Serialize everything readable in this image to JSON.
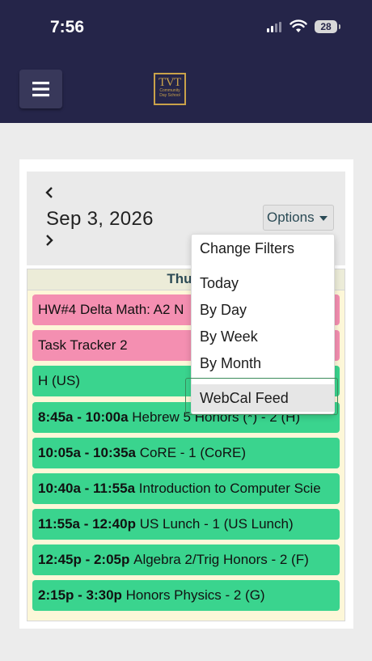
{
  "status_bar": {
    "time": "7:56",
    "battery": "28"
  },
  "header": {
    "menu_icon": "hamburger-icon",
    "logo": {
      "main": "TVT",
      "line1": "Community",
      "line2": "Day School"
    }
  },
  "calendar": {
    "date": "Sep 3, 2026",
    "prev_icon": "chevron-left-icon",
    "next_icon": "chevron-right-icon",
    "options_label": "Options",
    "day_header": "Thurs",
    "events": [
      {
        "time": "",
        "title": "HW#4 Delta Math: A2 N",
        "color": "pink"
      },
      {
        "time": "",
        "title": "Task Tracker 2",
        "color": "pink"
      },
      {
        "time": "",
        "title": "H (US)",
        "color": "green"
      },
      {
        "time": "8:45a - 10:00a",
        "title": "Hebrew 5 Honors (*) - 2 (H)",
        "color": "green"
      },
      {
        "time": "10:05a - 10:35a",
        "title": "CoRE - 1 (CoRE)",
        "color": "green"
      },
      {
        "time": "10:40a - 11:55a",
        "title": "Introduction to Computer Scie",
        "color": "green"
      },
      {
        "time": "11:55a - 12:40p",
        "title": "US Lunch - 1 (US Lunch)",
        "color": "green"
      },
      {
        "time": "12:45p - 2:05p",
        "title": "Algebra 2/Trig Honors - 2 (F)",
        "color": "green"
      },
      {
        "time": "2:15p - 3:30p",
        "title": "Honors Physics - 2 (G)",
        "color": "green"
      }
    ]
  },
  "options_menu": {
    "items": [
      "Change Filters",
      "Today",
      "By Day",
      "By Week",
      "By Month",
      "WebCal Feed"
    ],
    "highlighted": "WebCal Feed"
  },
  "colors": {
    "header_bg": "#252549",
    "event_pink": "#f48fb1",
    "event_green": "#3ad48e",
    "day_bg": "#fdf7d8",
    "logo_gold": "#c9a24a"
  }
}
